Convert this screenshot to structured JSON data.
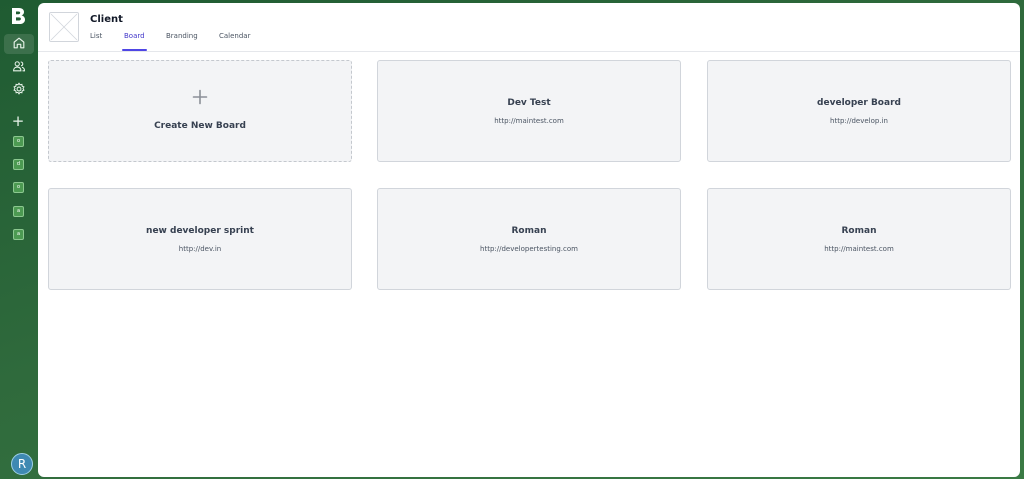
{
  "sidebar": {
    "logo_letter": "B",
    "nav": [
      {
        "name": "home-icon",
        "active": true
      },
      {
        "name": "users-icon",
        "active": false
      },
      {
        "name": "gear-icon",
        "active": false
      }
    ],
    "add_label": "+",
    "workspaces": [
      "o",
      "d",
      "o",
      "a",
      "a"
    ],
    "avatar_initial": "R"
  },
  "header": {
    "title": "Client",
    "tabs": [
      {
        "label": "List",
        "active": false
      },
      {
        "label": "Board",
        "active": true
      },
      {
        "label": "Branding",
        "active": false
      },
      {
        "label": "Calendar",
        "active": false
      }
    ]
  },
  "boards": {
    "create_label": "Create New Board",
    "items": [
      {
        "name": "Dev Test",
        "url": "http://maintest.com"
      },
      {
        "name": "developer Board",
        "url": "http://develop.in"
      },
      {
        "name": "new developer sprint",
        "url": "http://dev.in"
      },
      {
        "name": "Roman",
        "url": "http://developertesting.com"
      },
      {
        "name": "Roman",
        "url": "http://maintest.com"
      }
    ]
  },
  "colors": {
    "sidebar_bg": "#2f6a3c",
    "accent": "#4f46e5",
    "card_bg": "#f3f4f6",
    "avatar_bg": "#3f89b2"
  }
}
